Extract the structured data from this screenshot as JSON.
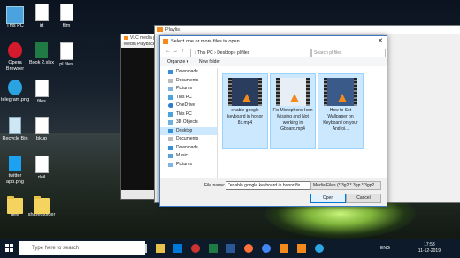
{
  "desktop": {
    "icons": [
      {
        "label": "This PC"
      },
      {
        "label": "jrt"
      },
      {
        "label": "film"
      },
      {
        "label": "Opera Browser"
      },
      {
        "label": "Book 2.xlsx"
      },
      {
        "label": "pl files"
      },
      {
        "label": "telegram.png"
      },
      {
        "label": "files"
      },
      {
        "label": "Recycle Bin"
      },
      {
        "label": "bkup"
      },
      {
        "label": "twitter app.png"
      },
      {
        "label": "dail"
      },
      {
        "label": "new"
      },
      {
        "label": "sharedfolder"
      }
    ]
  },
  "vlc": {
    "title": "VLC media pla",
    "menu": "Media  Playback"
  },
  "playlist": {
    "title": "Playlist"
  },
  "dialog": {
    "title": "Select one or more files to open",
    "breadcrumb": "› This PC › Desktop › pl files",
    "search_placeholder": "Search pl files",
    "organize": "Organize ▾",
    "new_folder": "New folder",
    "nav": [
      "Downloads",
      "Documents",
      "Pictures",
      "This PC",
      "OneDrive",
      "This PC",
      "3D Objects",
      "Desktop",
      "Documents",
      "Downloads",
      "Music",
      "Pictures"
    ],
    "files": [
      {
        "name": "enable google keyboard in honor 8x.mp4"
      },
      {
        "name": "Fix Microphone Icon Missing and Not working in Gboard.mp4"
      },
      {
        "name": "How to Set Wallpaper on Keyboard on your Androi..."
      }
    ],
    "filename_label": "File name:",
    "filename_value": "\"enable google keyboard in honor 8x",
    "filetype": "Media Files (*.3g2 *.3gp *.3gp2",
    "open": "Open",
    "cancel": "Cancel"
  },
  "taskbar": {
    "search_placeholder": "Type here to search",
    "time": "17:58",
    "date": "11-12-2019",
    "lang": "ENG"
  },
  "colors": {
    "selection": "#cce8ff",
    "accent": "#0078d7",
    "vlc": "#f38a1b"
  }
}
